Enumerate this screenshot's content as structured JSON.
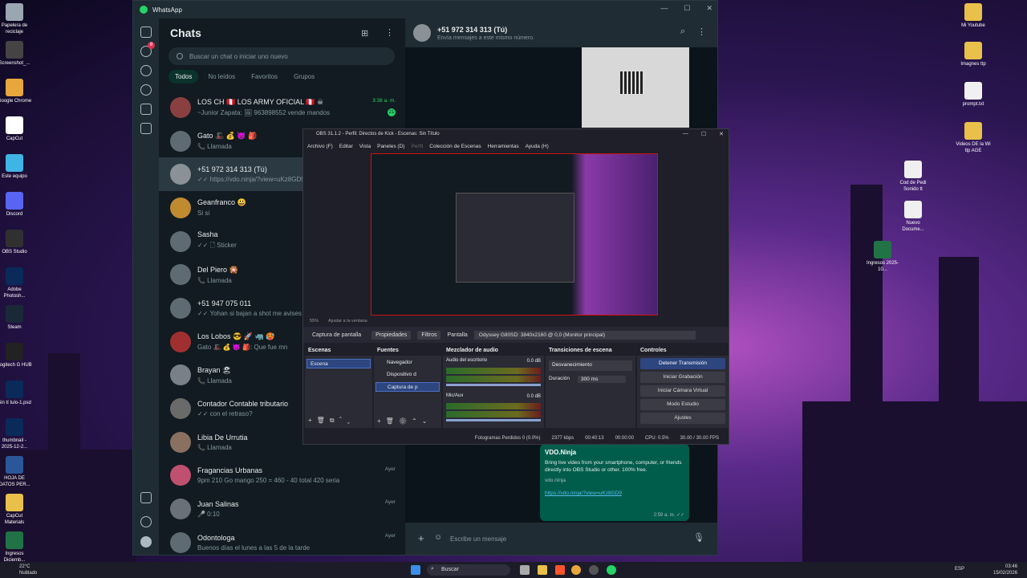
{
  "desktop_left": [
    {
      "label": "Papelera de reciclaje",
      "color": "#9aa6b2"
    },
    {
      "label": "Screenshot_...",
      "color": "#444444"
    },
    {
      "label": "Google Chrome",
      "color": "#e8a73c"
    },
    {
      "label": "CapCut",
      "color": "#ffffff"
    },
    {
      "label": "Este equipo",
      "color": "#3fb5e6"
    },
    {
      "label": "Discord",
      "color": "#5865f2"
    },
    {
      "label": "OBS Studio",
      "color": "#303030"
    },
    {
      "label": "Adobe Photosh...",
      "color": "#0a2a5a"
    },
    {
      "label": "Steam",
      "color": "#1b2838"
    },
    {
      "label": "Logitech G HUB",
      "color": "#222222"
    },
    {
      "label": "Sin tí tulo-1.psd",
      "color": "#0a2a5a"
    },
    {
      "label": "thumbnail - 2025-12-2...",
      "color": "#0a2a5a"
    },
    {
      "label": "HOJA DE DATOS PER...",
      "color": "#2b579a"
    },
    {
      "label": "CapCut Materials",
      "color": "#e8c04a"
    },
    {
      "label": "Ingresos Diciemb...",
      "color": "#217346"
    }
  ],
  "desktop_right": [
    {
      "label": "Mi Youtube",
      "color": "#e8c04a"
    },
    {
      "label": "Imagnes ttp",
      "color": "#e8c04a"
    },
    {
      "label": "prompt.txt",
      "color": "#f0f0f0"
    },
    {
      "label": "Videos DE la Wi ttp AGE",
      "color": "#e8c04a"
    },
    {
      "label": "Cod de Pedi Sonido tt",
      "color": "#f0f0f0"
    },
    {
      "label": "Nuevo Docume...",
      "color": "#f0f0f0"
    },
    {
      "label": "Ingresos 2025-10...",
      "color": "#217346"
    }
  ],
  "whatsapp": {
    "window_title": "WhatsApp",
    "rail_badge": "8",
    "list_title": "Chats",
    "search_placeholder": "Buscar un chat o iniciar uno nuevo",
    "filters": [
      "Todos",
      "No leídos",
      "Favoritos",
      "Grupos"
    ],
    "chats": [
      {
        "name": "LOS CH 🇵🇪 LOS ARMY OFICIAL 🇵🇪 ☠",
        "msg": "~Junior Zapata: 🖼 963898552 vende mandos",
        "time": "3:38 a. m.",
        "unread": "21"
      },
      {
        "name": "Gato 🎩 💰 👿 🎒",
        "msg": "📞 Llamada",
        "time": "",
        "unread": ""
      },
      {
        "name": "+51 972 314 313 (Tú)",
        "msg": "✓✓ https://vdo.ninja/?view=uKz8GD9",
        "time": "",
        "unread": ""
      },
      {
        "name": "Geanfranco 😃",
        "msg": "Si si",
        "time": "",
        "unread": ""
      },
      {
        "name": "Sasha",
        "msg": "✓✓ 🗋 Sticker",
        "time": "",
        "unread": ""
      },
      {
        "name": "Del Piero 🎇",
        "msg": "📞 Llamada",
        "time": "",
        "unread": ""
      },
      {
        "name": "+51 947 075 011",
        "msg": "✓✓ Yohan si bajan a shot me avises pa",
        "time": "",
        "unread": ""
      },
      {
        "name": "Los Lobos 😎 🚀 🦏 🥵",
        "msg": "Gato 🎩 💰 👿 🎒: Que fue mn",
        "time": "",
        "unread": ""
      },
      {
        "name": "Brayan 🏖",
        "msg": "📞 Llamada",
        "time": "",
        "unread": ""
      },
      {
        "name": "Contador Contable tributario",
        "msg": "✓✓ con el retraso?",
        "time": "",
        "unread": ""
      },
      {
        "name": "Libia De Urrutia",
        "msg": "📞 Llamada",
        "time": "",
        "unread": ""
      },
      {
        "name": "Fragancias Urbanas",
        "msg": "9pm 210 Go mango 250 = 460 - 40 total 420 seria",
        "time": "Ayer",
        "unread": ""
      },
      {
        "name": "Juan Salinas",
        "msg": "🎤 0:10",
        "time": "Ayer",
        "unread": ""
      },
      {
        "name": "Odontologa",
        "msg": "Buenos días el lunes a las 5 de la tarde",
        "time": "Ayer",
        "unread": ""
      }
    ],
    "conv_name": "+51 972 314 313 (Tú)",
    "conv_sub": "Envía mensajes a este mismo número.",
    "vdo_title": "VDO.Ninja",
    "vdo_desc": "Bring live video from your smartphone, computer, or friends directly into OBS Studio or other. 100% free.",
    "vdo_domain": "vdo.ninja",
    "vdo_link": "https://vdo.ninja/?view=uKz8GD9",
    "vdo_time": "2:59 a. m. ✓✓",
    "input_placeholder": "Escribe un mensaje"
  },
  "obs": {
    "title": "OBS 31.1.2 - Perfil: Directos de Kick - Escenas: Sin Título",
    "menu": [
      "Archivo (F)",
      "Editar",
      "Vista",
      "Paneles (D)",
      "Perfil",
      "Colección de Escenas",
      "Herramientas",
      "Ayuda (H)"
    ],
    "zoom": "55%",
    "fit": "Ajustar a la ventana",
    "src_capture": "Captura de pantalla",
    "props": "Propiedades",
    "filters": "Filtros",
    "screen_label": "Pantalla",
    "monitor": "Odyssey G80SD: 3840x2160 @ 0,0 (Monitor principal)",
    "docks": {
      "scenes": "Escenas",
      "sources": "Fuentes",
      "mixer": "Mezclador de audio",
      "transitions": "Transiciones de escena",
      "controls": "Controles"
    },
    "scene": "Escena",
    "sources_list": [
      "Navegador",
      "Dispositivo d",
      "Captura de p"
    ],
    "mixer": [
      {
        "name": "Audio del escritorio",
        "db": "0.0 dB"
      },
      {
        "name": "Mic/Aux",
        "db": "0.0 dB"
      }
    ],
    "transition": "Desvanecimiento",
    "duration_label": "Duración",
    "duration": "300 ms",
    "controls": [
      "Detener Transmisión",
      "Iniciar Grabación",
      "Iniciar Cámara Virtual",
      "Modo Estudio",
      "Ajustes"
    ],
    "status": [
      "Fotogramas Perdidos 0 (0.0%)",
      "2377 kbps",
      "00:40:13",
      "00:00:00",
      "CPU: 0.5%",
      "30.00 / 30.00 FPS"
    ]
  },
  "taskbar": {
    "weather_temp": "22°C",
    "weather_desc": "Nublado",
    "search": "Buscar",
    "lang": "ESP",
    "time": "03:46",
    "date": "15/02/2026"
  }
}
